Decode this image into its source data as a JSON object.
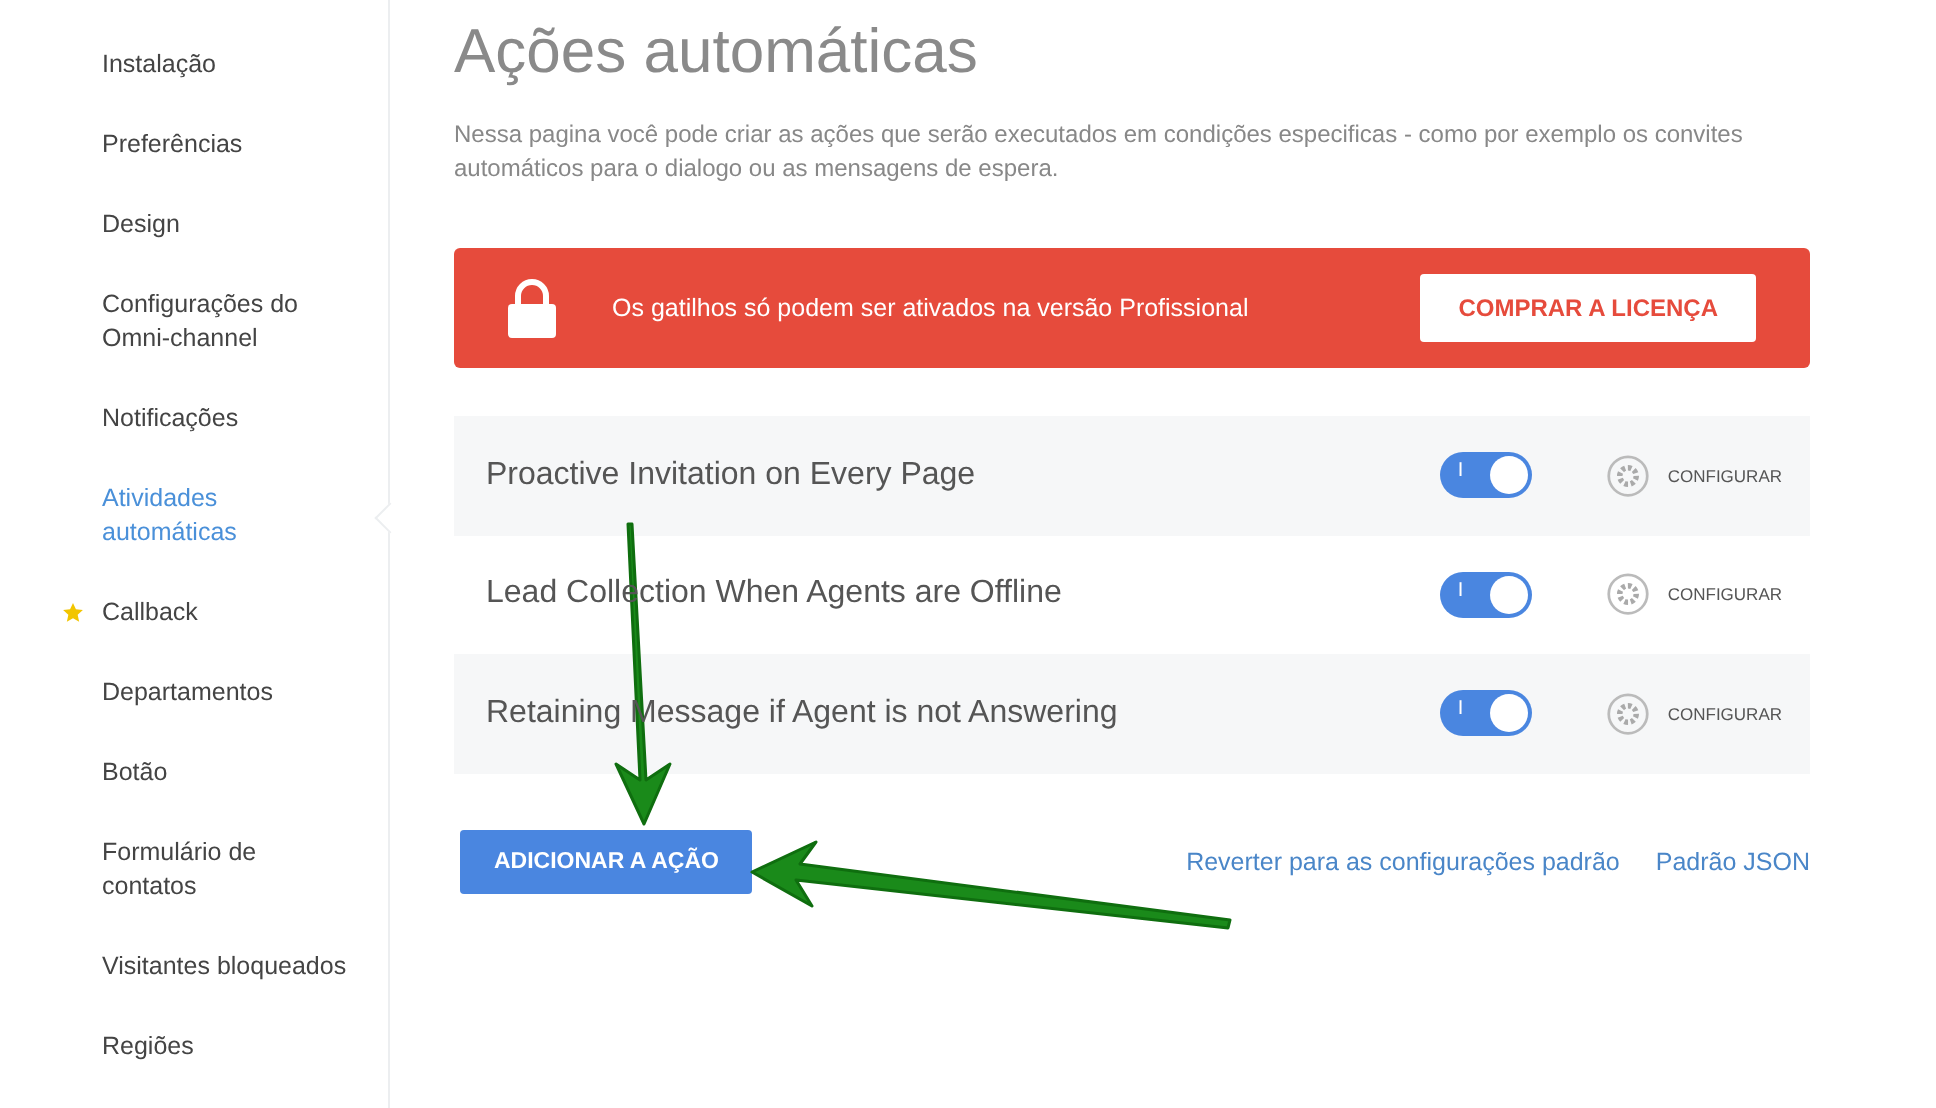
{
  "sidebar": {
    "items": [
      {
        "label": "Instalação",
        "selected": false,
        "starred": false
      },
      {
        "label": "Preferências",
        "selected": false,
        "starred": false
      },
      {
        "label": "Design",
        "selected": false,
        "starred": false
      },
      {
        "label": "Configurações do Omni-channel",
        "selected": false,
        "starred": false
      },
      {
        "label": "Notificações",
        "selected": false,
        "starred": false
      },
      {
        "label": "Atividades automáticas",
        "selected": true,
        "starred": false
      },
      {
        "label": "Callback",
        "selected": false,
        "starred": true
      },
      {
        "label": "Departamentos",
        "selected": false,
        "starred": false
      },
      {
        "label": "Botão",
        "selected": false,
        "starred": false
      },
      {
        "label": "Formulário de contatos",
        "selected": false,
        "starred": false
      },
      {
        "label": "Visitantes bloqueados",
        "selected": false,
        "starred": false
      },
      {
        "label": "Regiões",
        "selected": false,
        "starred": false
      }
    ]
  },
  "page": {
    "title": "Ações automáticas",
    "description": "Nessa pagina você pode criar as ações que serão executados em condições especificas - como por exemplo os convites automáticos para o dialogo ou as mensagens de espera."
  },
  "banner": {
    "message": "Os gatilhos só podem ser ativados na versão Profissional",
    "button": "COMPRAR A LICENÇA"
  },
  "actions": [
    {
      "name": "Proactive Invitation on Every Page",
      "on": true,
      "toggle_mark": "I",
      "configure": "CONFIGURAR"
    },
    {
      "name": "Lead Collection When Agents are Offline",
      "on": true,
      "toggle_mark": "I",
      "configure": "CONFIGURAR"
    },
    {
      "name": "Retaining Message if Agent is not Answering",
      "on": true,
      "toggle_mark": "I",
      "configure": "CONFIGURAR"
    }
  ],
  "footer": {
    "add_button": "ADICIONAR A AÇÃO",
    "links": [
      "Reverter para as configurações padrão",
      "Padrão JSON"
    ]
  }
}
